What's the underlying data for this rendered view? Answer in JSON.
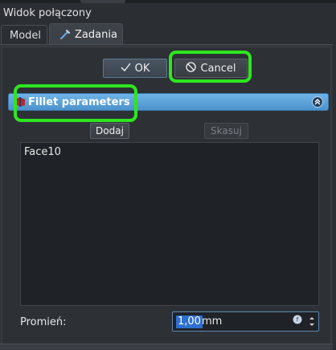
{
  "window": {
    "title": "Widok połączony"
  },
  "tabs": [
    {
      "label": "Model",
      "active": false
    },
    {
      "label": "Zadania",
      "active": true,
      "icon": "tasks-icon"
    }
  ],
  "dialog": {
    "ok_label": "OK",
    "cancel_label": "Cancel",
    "ok_icon": "checkmark-icon",
    "cancel_icon": "cancel-icon"
  },
  "section": {
    "title": "Fillet parameters",
    "icon": "fillet-icon",
    "collapse_icon": "collapse-icon",
    "add_label": "Dodaj",
    "remove_label": "Skasuj",
    "items": [
      "Face10"
    ]
  },
  "radius": {
    "label": "Promień:",
    "value": "1,00",
    "unit": "mm",
    "expression_icon": "expression-icon"
  },
  "colors": {
    "highlight": "#2ee61f",
    "section_header": "#5aa3dc",
    "selection": "#2f6fcf"
  }
}
